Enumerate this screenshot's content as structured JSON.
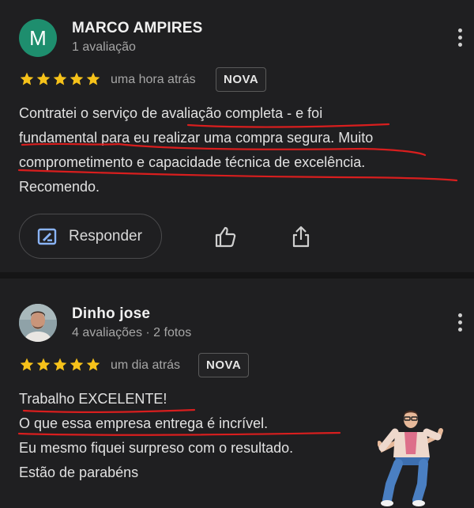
{
  "reviews": [
    {
      "avatar_letter": "M",
      "avatar_color": "#1e8e6e",
      "name": "MARCO AMPIRES",
      "meta": "1 avaliação",
      "rating": 5,
      "time": "uma hora atrás",
      "badge": "NOVA",
      "lines": [
        "Contratei o serviço de avaliação completa - e foi",
        "fundamental para eu realizar uma compra segura. Muito",
        "comprometimento e capacidade técnica de excelência.",
        "Recomendo."
      ],
      "reply_label": "Responder"
    },
    {
      "name": "Dinho jose",
      "meta": "4 avaliações · 2 fotos",
      "rating": 5,
      "time": "um dia atrás",
      "badge": "NOVA",
      "lines": [
        "Trabalho EXCELENTE!",
        "O que essa empresa entrega é incrível.",
        "Eu mesmo fiquei surpreso com o resultado.",
        "Estão de parabéns"
      ]
    }
  ],
  "colors": {
    "star": "#f6c21a",
    "underline": "#d81e1e",
    "background": "#1f1f21"
  },
  "icons": [
    "edit-reply-icon",
    "thumbs-up-icon",
    "share-icon",
    "more-options-icon",
    "star-icon"
  ]
}
